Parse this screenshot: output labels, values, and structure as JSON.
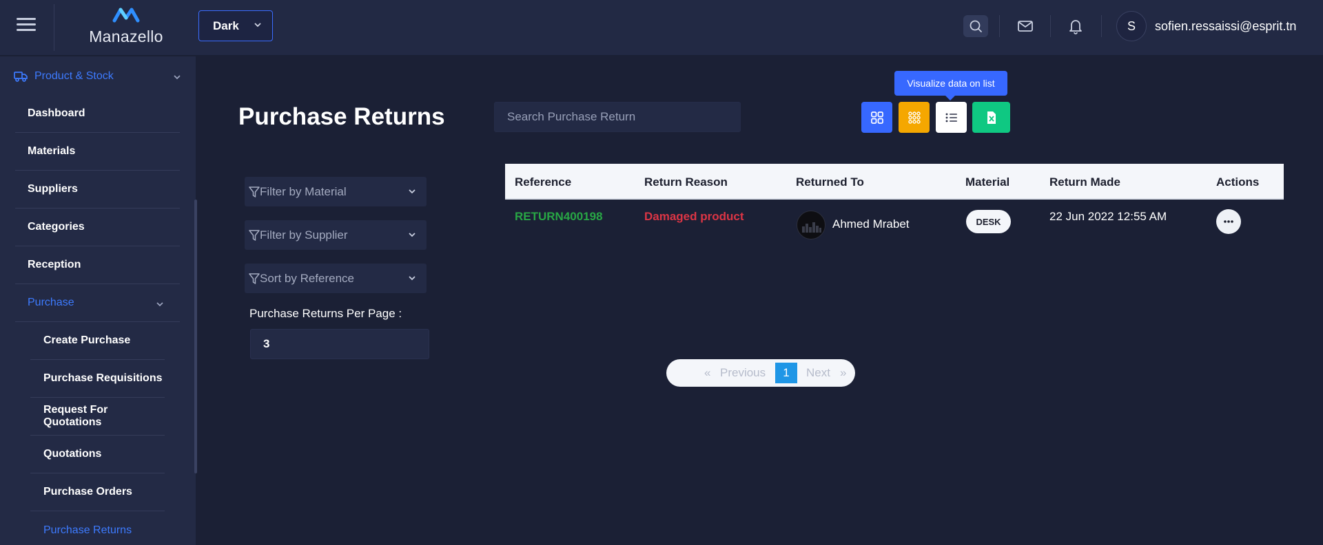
{
  "header": {
    "brand": "Manazello",
    "theme_value": "Dark",
    "user_initial": "S",
    "user_email": "sofien.ressaissi@esprit.tn"
  },
  "sidebar": {
    "section_label": "Product & Stock",
    "items": [
      {
        "label": "Dashboard"
      },
      {
        "label": "Materials"
      },
      {
        "label": "Suppliers"
      },
      {
        "label": "Categories"
      },
      {
        "label": "Reception"
      },
      {
        "label": "Purchase"
      }
    ],
    "subitems": [
      {
        "label": "Create Purchase"
      },
      {
        "label": "Purchase Requisitions"
      },
      {
        "label": "Request For Quotations"
      },
      {
        "label": "Quotations"
      },
      {
        "label": "Purchase Orders"
      },
      {
        "label": "Purchase Returns"
      }
    ]
  },
  "main": {
    "title": "Purchase Returns",
    "search_placeholder": "Search Purchase Return",
    "tooltip": "Visualize data on list",
    "filters": [
      {
        "label": "Filter by Material"
      },
      {
        "label": "Filter by Supplier"
      },
      {
        "label": "Sort by Reference"
      }
    ],
    "per_page_label": "Purchase Returns Per Page :",
    "per_page_value": "3"
  },
  "table": {
    "columns": [
      "Reference",
      "Return Reason",
      "Returned To",
      "Material",
      "Return Made",
      "Actions"
    ],
    "rows": [
      {
        "reference": "RETURN400198",
        "reason": "Damaged product",
        "returned_to": "Ahmed Mrabet",
        "material": "DESK",
        "return_made": "22 Jun 2022 12:55 AM"
      }
    ]
  },
  "pagination": {
    "first": "«",
    "previous": "Previous",
    "current": "1",
    "next": "Next",
    "last": "»"
  },
  "colors": {
    "accent": "#3d7bff",
    "reference": "#28a745",
    "reason": "#dc3545",
    "grid_view_btn": "#3768ff",
    "compact_view_btn": "#f5a700",
    "list_view_btn": "#ffffff",
    "excel_btn": "#0fc882"
  }
}
